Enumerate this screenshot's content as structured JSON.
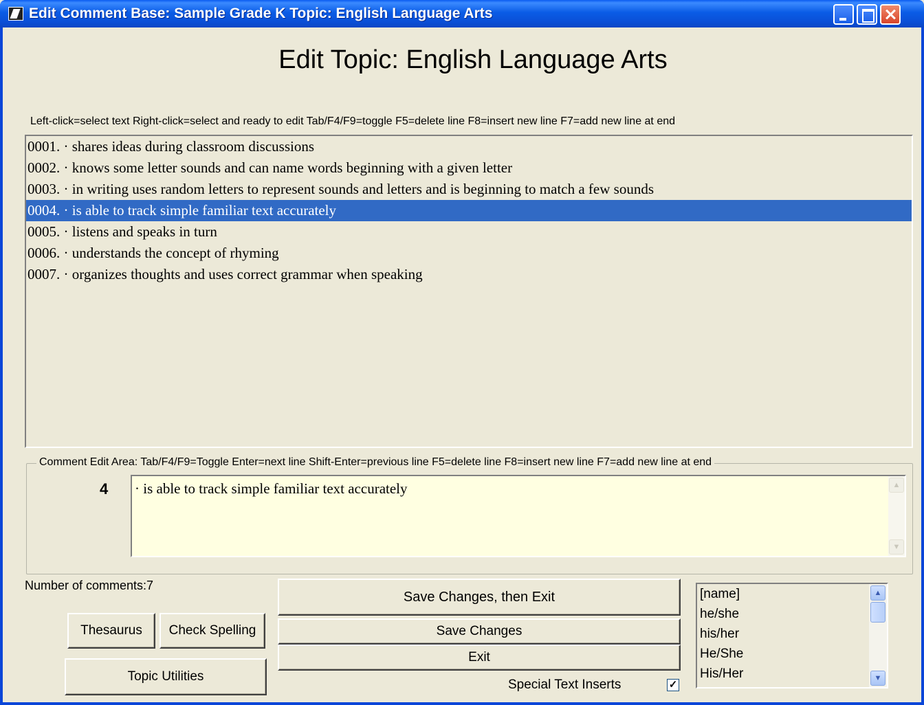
{
  "window": {
    "title": "Edit Comment Base: Sample Grade K  Topic: English Language Arts"
  },
  "heading": "Edit Topic: English Language Arts",
  "hint_bar": "Left-click=select text   Right-click=select and ready to edit   Tab/F4/F9=toggle   F5=delete line   F8=insert new line   F7=add new line at end",
  "comments": [
    {
      "label": "0001. · shares ideas during classroom discussions"
    },
    {
      "label": "0002. · knows some letter sounds and can name words beginning with a given letter"
    },
    {
      "label": "0003. · in writing uses random letters to represent sounds and letters and is beginning to match a few sounds"
    },
    {
      "label": "0004. · is able to track simple familiar text accurately"
    },
    {
      "label": "0005. · listens and speaks in turn"
    },
    {
      "label": "0006. · understands the concept of rhyming"
    },
    {
      "label": "0007. · organizes thoughts and uses correct grammar when speaking"
    }
  ],
  "selected_index": 3,
  "edit_area": {
    "legend": "Comment Edit Area:  Tab/F4/F9=Toggle   Enter=next line   Shift-Enter=previous line   F5=delete line   F8=insert new line   F7=add new line at end",
    "line_number": "4",
    "text": "· is able to track simple familiar text accurately"
  },
  "count_label": "Number of comments:7",
  "buttons": {
    "thesaurus": "Thesaurus",
    "check_spelling": "Check Spelling",
    "topic_utilities": "Topic Utilities",
    "save_exit": "Save Changes, then Exit",
    "save": "Save Changes",
    "exit": "Exit"
  },
  "special_inserts": {
    "label": "Special Text Inserts",
    "checked": true,
    "items": [
      "[name]",
      "he/she",
      "his/her",
      "He/She",
      "His/Her"
    ]
  },
  "colors": {
    "selection": "#316ac5",
    "edit_background": "#ffffe1",
    "window_face": "#ece9d8"
  }
}
